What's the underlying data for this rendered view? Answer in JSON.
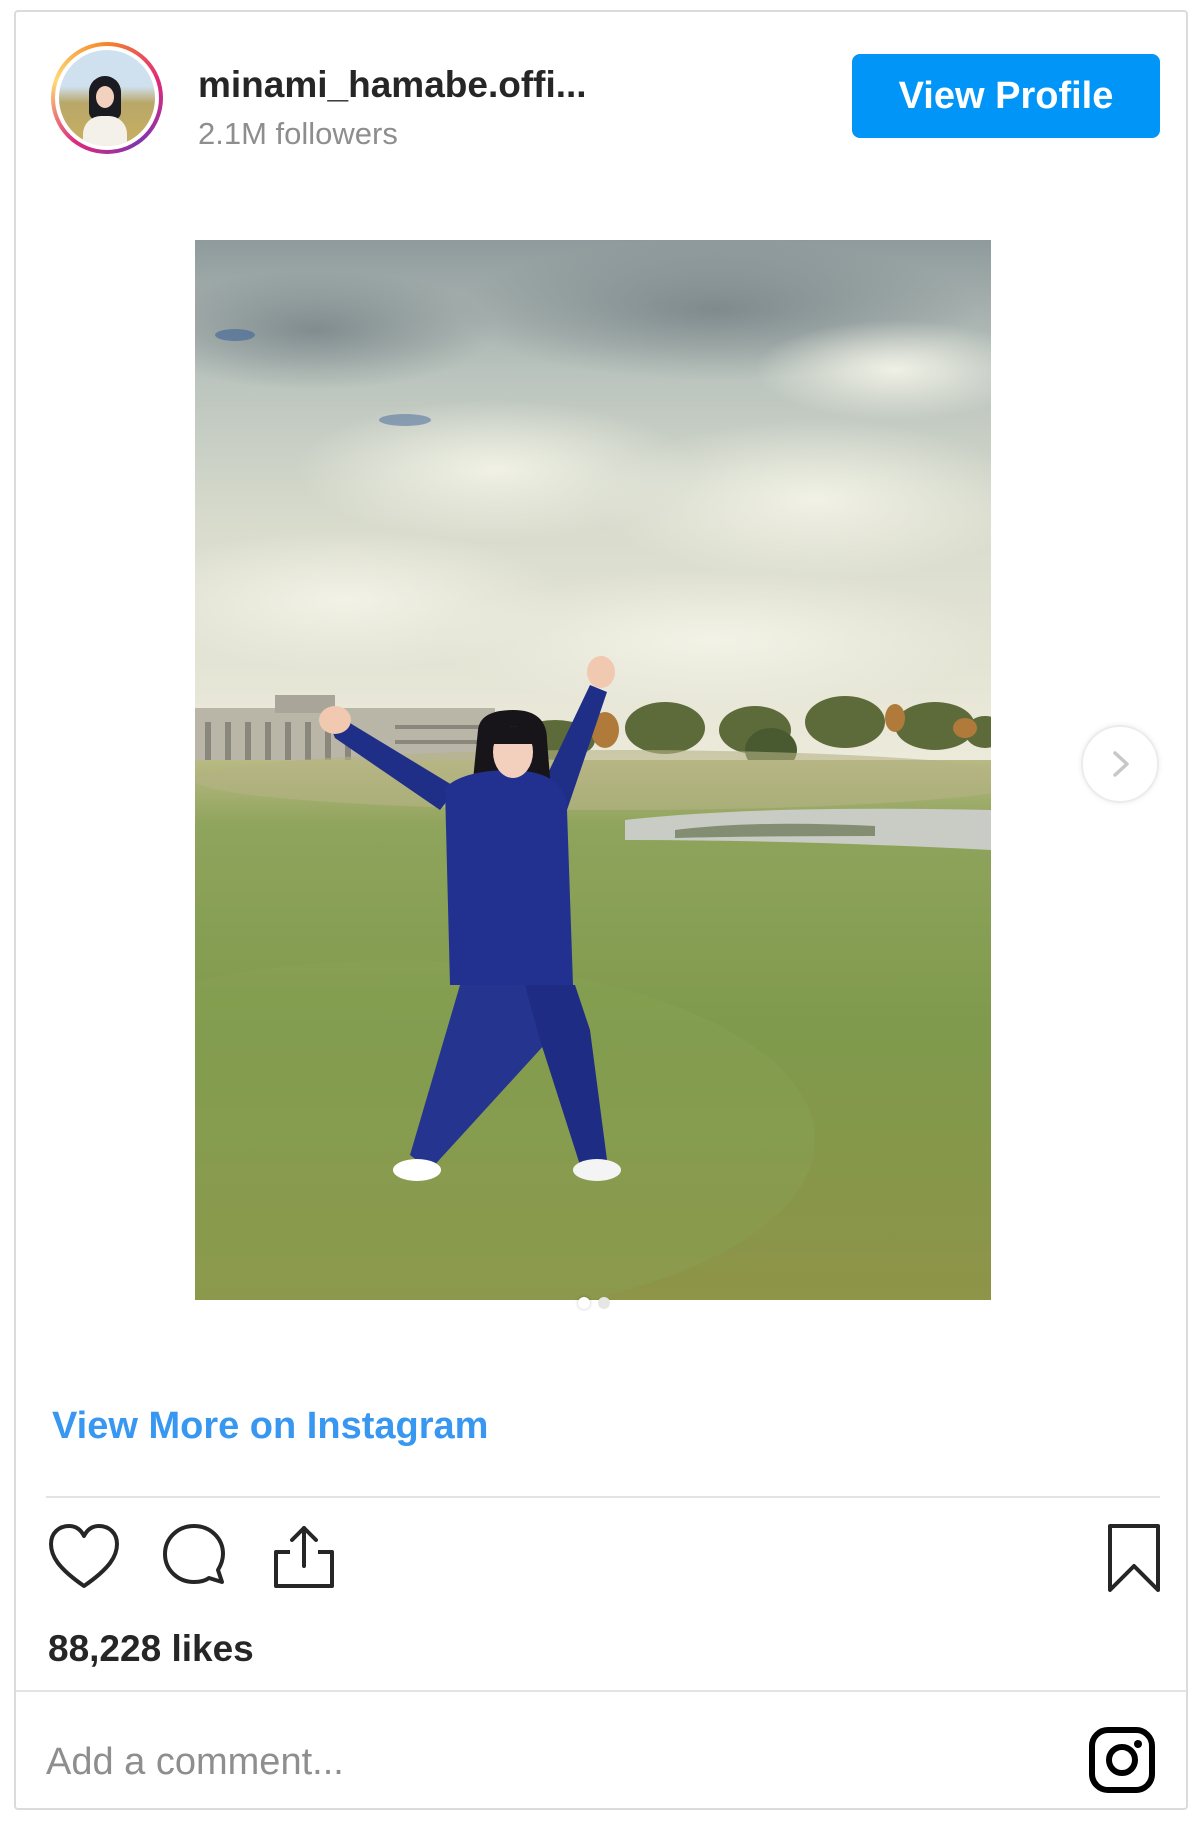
{
  "header": {
    "username": "minami_hamabe.offi...",
    "followers": "2.1M followers",
    "view_profile_label": "View Profile"
  },
  "post": {
    "view_more_label": "View More on Instagram",
    "likes": "88,228 likes",
    "carousel": {
      "slide_count": 2,
      "active_slide": 1
    }
  },
  "comment": {
    "placeholder": "Add a comment..."
  },
  "icons": {
    "like": "heart-icon",
    "comment": "comment-icon",
    "share": "share-icon",
    "save": "bookmark-icon",
    "brand": "instagram-icon",
    "next": "chevron-right-icon"
  },
  "colors": {
    "accent": "#0095f6",
    "link": "#3897f0",
    "text": "#262626",
    "muted": "#8e8e8e",
    "border": "#dbdbdb"
  }
}
